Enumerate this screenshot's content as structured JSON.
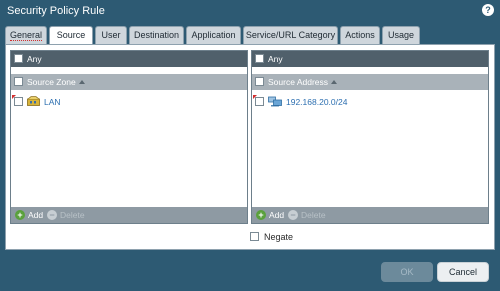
{
  "dialog": {
    "title": "Security Policy Rule",
    "help_icon": "question-icon"
  },
  "tabs": [
    {
      "label": "General"
    },
    {
      "label": "Source"
    },
    {
      "label": "User"
    },
    {
      "label": "Destination"
    },
    {
      "label": "Application"
    },
    {
      "label": "Service/URL Category"
    },
    {
      "label": "Actions"
    },
    {
      "label": "Usage"
    }
  ],
  "active_tab": "Source",
  "left_panel": {
    "any_label": "Any",
    "column_header": "Source Zone",
    "rows": [
      {
        "label": "LAN",
        "icon": "zone-icon"
      }
    ],
    "add_label": "Add",
    "delete_label": "Delete"
  },
  "right_panel": {
    "any_label": "Any",
    "column_header": "Source Address",
    "rows": [
      {
        "label": "192.168.20.0/24",
        "icon": "network-address-icon"
      }
    ],
    "add_label": "Add",
    "delete_label": "Delete"
  },
  "negate_label": "Negate",
  "buttons": {
    "ok": "OK",
    "cancel": "Cancel"
  },
  "colors": {
    "frame": "#2d5a73",
    "header_bar": "#50606b",
    "link": "#2d6fb0",
    "add_green": "#5aa13c"
  }
}
